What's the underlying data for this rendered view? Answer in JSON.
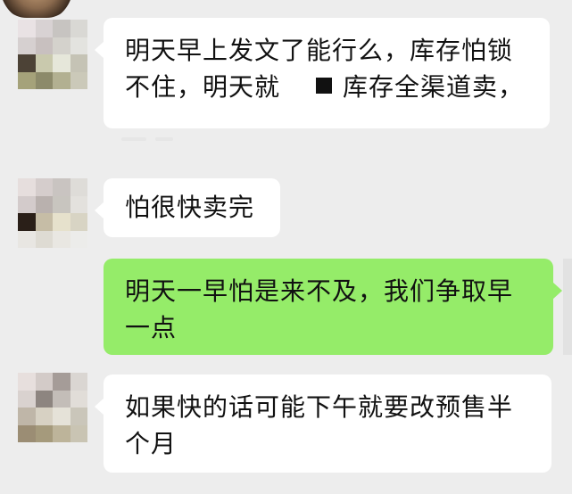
{
  "chat": {
    "messages": [
      {
        "side": "left",
        "lines": [
          "明天早上发文了能行么，库存怕锁",
          "不住，明天就",
          "库存全渠道卖，"
        ]
      },
      {
        "side": "left",
        "lines": [
          "怕很快卖完"
        ]
      },
      {
        "side": "right",
        "lines": [
          "明天一早怕是来不及，我们争取早",
          "一点"
        ]
      },
      {
        "side": "left",
        "lines": [
          "如果快的话可能下午就要改预售半",
          "个月"
        ]
      }
    ]
  },
  "colors": {
    "background": "#ededed",
    "incoming_bubble": "#ffffff",
    "outgoing_bubble": "#95ec69",
    "text": "#111111"
  },
  "icons": {
    "avatar": "mosaic-avatar",
    "redaction": "black-square"
  }
}
